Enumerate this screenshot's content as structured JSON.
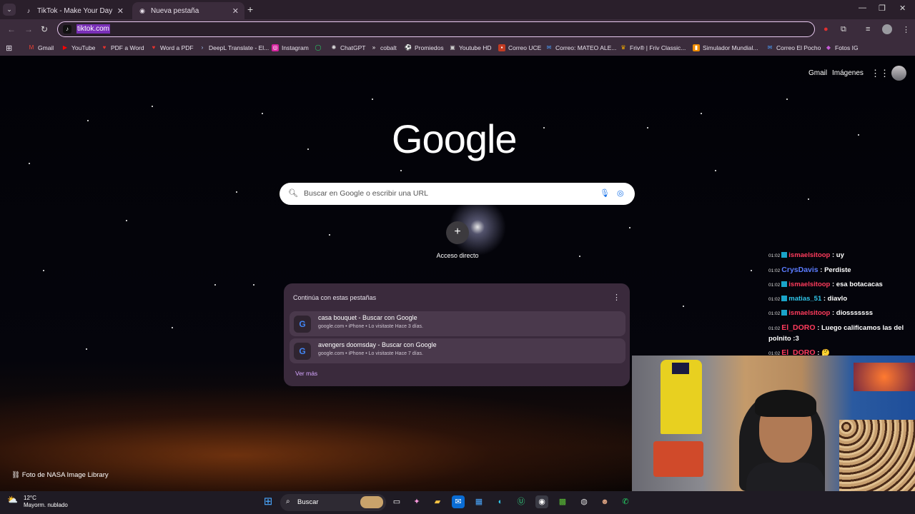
{
  "browser": {
    "tabs": [
      {
        "title": "TikTok - Make Your Day",
        "icon": "tiktok-icon",
        "active": false
      },
      {
        "title": "Nueva pestaña",
        "icon": "chrome-icon",
        "active": true
      }
    ],
    "address": {
      "value": "tiktok.com"
    },
    "bookmarks": [
      {
        "label": "Gmail",
        "icon": "gmail-icon",
        "color": "#ea4335"
      },
      {
        "label": "YouTube",
        "icon": "youtube-icon",
        "color": "#ff0000"
      },
      {
        "label": "PDF a Word",
        "icon": "pdf-icon",
        "color": "#e5322d"
      },
      {
        "label": "Word a PDF",
        "icon": "pdf-icon",
        "color": "#e5322d"
      },
      {
        "label": "DeepL Translate - El...",
        "icon": "deepl-icon",
        "color": "#0f2b46"
      },
      {
        "label": "Instagram",
        "icon": "instagram-icon",
        "color": "#d6249f"
      },
      {
        "label": "",
        "icon": "whatsapp-icon",
        "color": "#25d366"
      },
      {
        "label": "ChatGPT",
        "icon": "chatgpt-icon",
        "color": "#74aa9c"
      },
      {
        "label": "cobalt",
        "icon": "cobalt-icon",
        "color": "#111111"
      },
      {
        "label": "Promiedos",
        "icon": "promiedos-icon",
        "color": "#3a9b3a"
      },
      {
        "label": "Youtube HD",
        "icon": "image-icon",
        "color": "#cccccc"
      },
      {
        "label": "Correo UCE",
        "icon": "outlook-icon",
        "color": "#c23b22"
      },
      {
        "label": "Correo: MATEO ALE...",
        "icon": "outlook-icon",
        "color": "#0a6cd4"
      },
      {
        "label": "Friv® | Friv Classic...",
        "icon": "friv-icon",
        "color": "#f2a900"
      },
      {
        "label": "Simulador Mundial...",
        "icon": "simulator-icon",
        "color": "#f08c00"
      },
      {
        "label": "Correo El Pocho",
        "icon": "outlook-icon",
        "color": "#0a6cd4"
      },
      {
        "label": "Fotos IG",
        "icon": "bookmark-icon",
        "color": "#c65bd6"
      }
    ]
  },
  "newtab": {
    "gmail_link": "Gmail",
    "images_link": "Imágenes",
    "logo": "Google",
    "search_placeholder": "Buscar en Google o escribir una URL",
    "shortcut_label": "Acceso directo",
    "shortcut_symbol": "+",
    "continue_card": {
      "heading": "Continúa con estas pestañas",
      "items": [
        {
          "title": "casa bouquet - Buscar con Google",
          "subtitle": "google.com • iPhone • Lo visitaste Hace 3 días."
        },
        {
          "title": "avengers doomsday - Buscar con Google",
          "subtitle": "google.com • iPhone • Lo visitaste Hace 7 días."
        }
      ],
      "more": "Ver más"
    },
    "photo_credit": "Foto de NASA Image Library"
  },
  "chat": [
    {
      "time": "01:02",
      "user": "ismaelsitoop",
      "color": "#ff3b5c",
      "msg": ": uy"
    },
    {
      "time": "01:02",
      "user": "CrysDavis",
      "color": "#5b7cff",
      "msg": ": Perdiste"
    },
    {
      "time": "01:02",
      "user": "ismaelsitoop",
      "color": "#ff3b5c",
      "msg": ": esa botacacas"
    },
    {
      "time": "01:02",
      "user": "matias_51",
      "color": "#2fc4e8",
      "msg": ": diavlo"
    },
    {
      "time": "01:02",
      "user": "ismaelsitoop",
      "color": "#ff3b5c",
      "msg": ": diosssssss"
    },
    {
      "time": "01:02",
      "user": "El_DORO",
      "color": "#ff3b5c",
      "msg": ": Luego calificamos las del polnito :3"
    },
    {
      "time": "01:02",
      "user": "El_DORO",
      "color": "#ff3b5c",
      "msg": ": 🤔"
    }
  ],
  "taskbar": {
    "weather_temp": "12°C",
    "weather_desc": "Mayorm. nublado",
    "search_label": "Buscar"
  }
}
